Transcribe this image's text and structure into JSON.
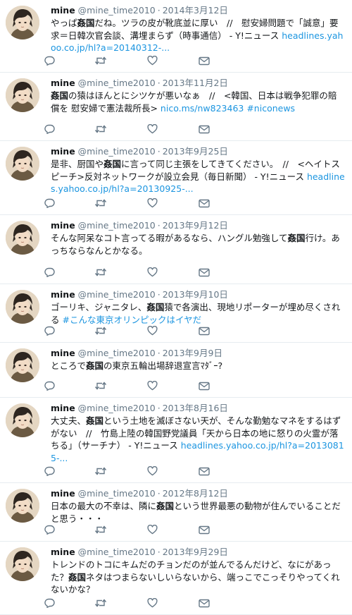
{
  "tweets": [
    {
      "name": "mine",
      "handle": "@mine_time2010",
      "date": "2014年3月12日",
      "segments": [
        {
          "t": "やっぱ"
        },
        {
          "t": "姦国",
          "k": "kw"
        },
        {
          "t": "だね。ツラの皮が靴底並に厚い　//　慰安婦問題で「誠意」要求＝日韓次官会談、溝埋まらず（時事通信） - Y!ニュース "
        },
        {
          "t": "headlines.yahoo.co.jp/hl?a=20140312-...",
          "k": "link"
        }
      ]
    },
    {
      "name": "mine",
      "handle": "@mine_time2010",
      "date": "2013年11月2日",
      "segments": [
        {
          "t": "姦国",
          "k": "kw"
        },
        {
          "t": "の猿はほんとにシツケが悪いなぁ　//　<韓国、日本は戦争犯罪の賠償を 慰安婦で憲法裁所長> "
        },
        {
          "t": "nico.ms/nw823463 #niconews",
          "k": "link"
        }
      ]
    },
    {
      "name": "mine",
      "handle": "@mine_time2010",
      "date": "2013年9月25日",
      "segments": [
        {
          "t": "是非、厨国や"
        },
        {
          "t": "姦国",
          "k": "kw"
        },
        {
          "t": "に言って同じ主張をしてきてください。　//　<ヘイトスピーチ>反対ネットワークが設立会見（毎日新聞） - Y!ニュース "
        },
        {
          "t": "headlines.yahoo.co.jp/hl?a=20130925-...",
          "k": "link"
        }
      ]
    },
    {
      "name": "mine",
      "handle": "@mine_time2010",
      "date": "2013年9月12日",
      "segments": [
        {
          "t": "そんな阿呆なコト言ってる暇があるなら、ハングル勉強して"
        },
        {
          "t": "姦国",
          "k": "kw"
        },
        {
          "t": "行け。あっちならなんとかなる。"
        }
      ]
    },
    {
      "name": "mine",
      "handle": "@mine_time2010",
      "date": "2013年9月10日",
      "segments": [
        {
          "t": "ゴーリキ、ジャニタレ、"
        },
        {
          "t": "姦国",
          "k": "kw"
        },
        {
          "t": "猿で各演出、現地リポーターが埋め尽くされる "
        },
        {
          "t": "#こんな東京オリンピックはイヤだ",
          "k": "link"
        }
      ]
    },
    {
      "name": "mine",
      "handle": "@mine_time2010",
      "date": "2013年9月9日",
      "segments": [
        {
          "t": "ところで"
        },
        {
          "t": "姦国",
          "k": "kw"
        },
        {
          "t": "の東京五輪出場辞退宣言ﾏﾀﾞｰ?"
        }
      ]
    },
    {
      "name": "mine",
      "handle": "@mine_time2010",
      "date": "2013年8月16日",
      "segments": [
        {
          "t": "大丈夫、"
        },
        {
          "t": "姦国",
          "k": "kw"
        },
        {
          "t": "という土地を滅ぼさない天が、そんな勤勉なマネをするはずがない　//　竹島上陸の韓国野党議員「天から日本の地に怒りの火霊が落ちる」（サーチナ） - Y!ニュース "
        },
        {
          "t": "headlines.yahoo.co.jp/hl?a=20130815-...",
          "k": "link"
        }
      ]
    },
    {
      "name": "mine",
      "handle": "@mine_time2010",
      "date": "2012年8月12日",
      "segments": [
        {
          "t": "日本の最大の不幸は、隣に"
        },
        {
          "t": "姦国",
          "k": "kw"
        },
        {
          "t": "という世界最悪の動物が住んでいることだと思う・・・"
        }
      ]
    },
    {
      "name": "mine",
      "handle": "@mine_time2010",
      "date": "2013年9月29日",
      "segments": [
        {
          "t": "トレンドのトコにキムだのチョンだのが並んでるんだけど、なにがあった？"
        },
        {
          "t": "姦国",
          "k": "kw"
        },
        {
          "t": "ネタはつまらないしいらないから、端っこでこっそりやってくれないかな？"
        }
      ]
    }
  ],
  "icons": {
    "reply": "reply-icon",
    "retweet": "retweet-icon",
    "like": "heart-icon",
    "dm": "envelope-icon"
  },
  "colors": {
    "link": "#1b95e0",
    "muted": "#657786",
    "text": "#14171a",
    "divider": "#e6ecf0"
  }
}
